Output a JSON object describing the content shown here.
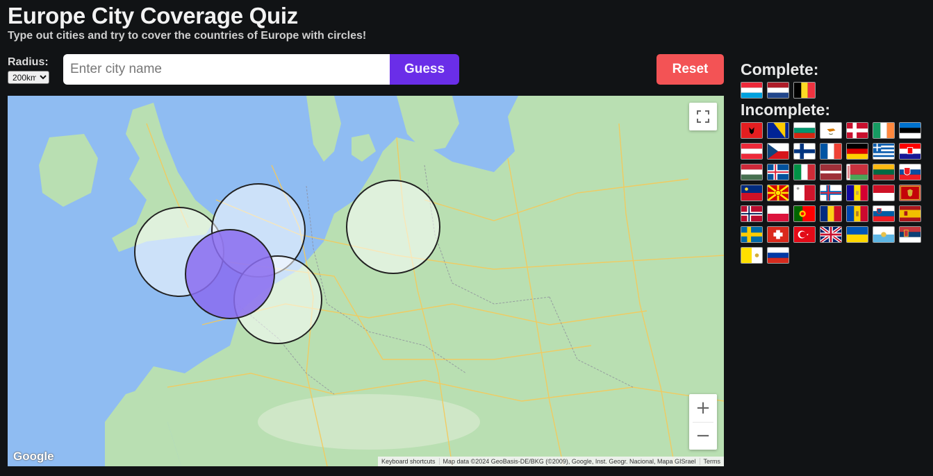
{
  "header": {
    "title": "Europe City Coverage Quiz",
    "subtitle": "Type out cities and try to cover the countries of Europe with circles!"
  },
  "controls": {
    "radius_label": "Radius:",
    "radius_value": "200km",
    "city_placeholder": "Enter city name",
    "guess_label": "Guess",
    "reset_label": "Reset"
  },
  "map": {
    "zoom_in": "+",
    "zoom_out": "−",
    "logo": "Google",
    "attribution": [
      "Keyboard shortcuts",
      "Map data ©2024 GeoBasis-DE/BKG (©2009), Google, Inst. Geogr. Nacional, Mapa GISrael",
      "Terms"
    ],
    "circle_color": "#8a6cf0"
  },
  "complete": {
    "label": "Complete:",
    "flags": [
      "luxembourg-flag",
      "netherlands-flag",
      "belgium-flag"
    ]
  },
  "incomplete": {
    "label": "Incomplete:",
    "flags": [
      "albania-flag",
      "bosnia-flag",
      "bulgaria-flag",
      "cyprus-flag",
      "denmark-flag",
      "ireland-flag",
      "estonia-flag",
      "austria-flag",
      "czechia-flag",
      "finland-flag",
      "france-flag",
      "germany-flag",
      "greece-flag",
      "croatia-flag",
      "hungary-flag",
      "iceland-flag",
      "italy-flag",
      "latvia-flag",
      "belarus-flag",
      "lithuania-flag",
      "slovakia-flag",
      "liechtenstein-flag",
      "north-macedonia-flag",
      "malta-flag",
      "faroe-islands-flag",
      "andorra-flag",
      "monaco-flag",
      "montenegro-flag",
      "norway-flag",
      "poland-flag",
      "portugal-flag",
      "romania-flag",
      "moldova-flag",
      "slovenia-flag",
      "spain-flag",
      "sweden-flag",
      "switzerland-flag",
      "turkey-flag",
      "united-kingdom-flag",
      "ukraine-flag",
      "san-marino-flag",
      "serbia-flag",
      "vatican-flag",
      "russia-flag"
    ]
  }
}
